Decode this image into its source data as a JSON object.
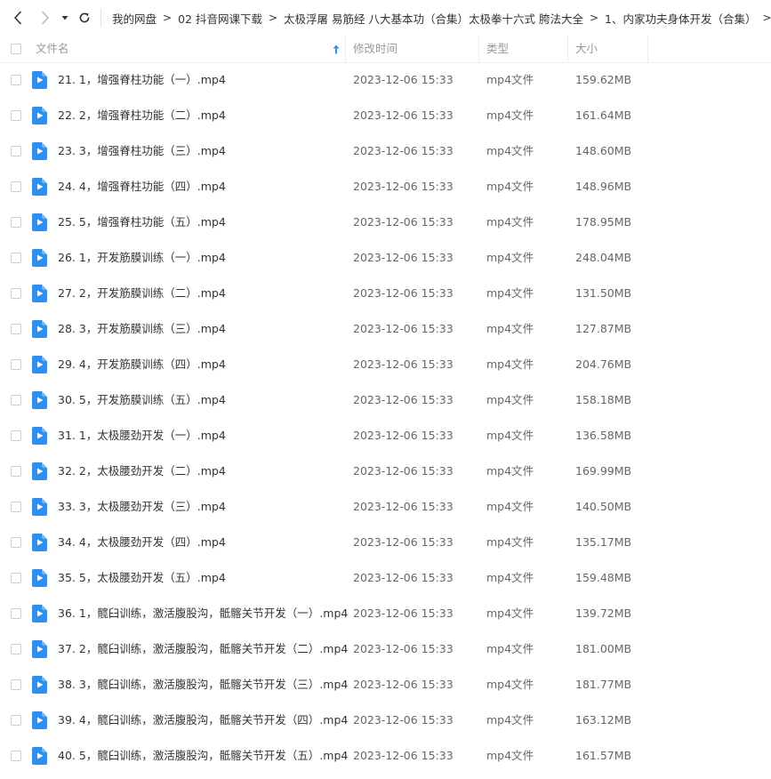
{
  "breadcrumb": [
    "我的网盘",
    "02 抖音网课下载",
    "太极浮屠 易筋经 八大基本功（合集）太极拳十六式 胯法大全",
    "1、内家功夫身体开发（合集）"
  ],
  "breadcrumb_separator": ">",
  "columns": {
    "name": "文件名",
    "modified": "修改时间",
    "type": "类型",
    "size": "大小"
  },
  "sort": {
    "column": "name",
    "direction": "ascending"
  },
  "colors": {
    "file_icon": "#2f8ff0",
    "sort_arrow": "#2f8ff0"
  },
  "files": [
    {
      "name": "21. 1，增强脊柱功能（一）.mp4",
      "modified": "2023-12-06 15:33",
      "type": "mp4文件",
      "size": "159.62MB"
    },
    {
      "name": "22. 2，增强脊柱功能（二）.mp4",
      "modified": "2023-12-06 15:33",
      "type": "mp4文件",
      "size": "161.64MB"
    },
    {
      "name": "23. 3，增强脊柱功能（三）.mp4",
      "modified": "2023-12-06 15:33",
      "type": "mp4文件",
      "size": "148.60MB"
    },
    {
      "name": "24. 4，增强脊柱功能（四）.mp4",
      "modified": "2023-12-06 15:33",
      "type": "mp4文件",
      "size": "148.96MB"
    },
    {
      "name": "25. 5，增强脊柱功能（五）.mp4",
      "modified": "2023-12-06 15:33",
      "type": "mp4文件",
      "size": "178.95MB"
    },
    {
      "name": "26. 1，开发筋膜训练（一）.mp4",
      "modified": "2023-12-06 15:33",
      "type": "mp4文件",
      "size": "248.04MB"
    },
    {
      "name": "27. 2，开发筋膜训练（二）.mp4",
      "modified": "2023-12-06 15:33",
      "type": "mp4文件",
      "size": "131.50MB"
    },
    {
      "name": "28. 3，开发筋膜训练（三）.mp4",
      "modified": "2023-12-06 15:33",
      "type": "mp4文件",
      "size": "127.87MB"
    },
    {
      "name": "29. 4，开发筋膜训练（四）.mp4",
      "modified": "2023-12-06 15:33",
      "type": "mp4文件",
      "size": "204.76MB"
    },
    {
      "name": "30. 5，开发筋膜训练（五）.mp4",
      "modified": "2023-12-06 15:33",
      "type": "mp4文件",
      "size": "158.18MB"
    },
    {
      "name": "31. 1，太极腰劲开发（一）.mp4",
      "modified": "2023-12-06 15:33",
      "type": "mp4文件",
      "size": "136.58MB"
    },
    {
      "name": "32. 2，太极腰劲开发（二）.mp4",
      "modified": "2023-12-06 15:33",
      "type": "mp4文件",
      "size": "169.99MB"
    },
    {
      "name": "33. 3，太极腰劲开发（三）.mp4",
      "modified": "2023-12-06 15:33",
      "type": "mp4文件",
      "size": "140.50MB"
    },
    {
      "name": "34. 4，太极腰劲开发（四）.mp4",
      "modified": "2023-12-06 15:33",
      "type": "mp4文件",
      "size": "135.17MB"
    },
    {
      "name": "35. 5，太极腰劲开发（五）.mp4",
      "modified": "2023-12-06 15:33",
      "type": "mp4文件",
      "size": "159.48MB"
    },
    {
      "name": "36. 1，髋臼训练，激活腹股沟，骶髂关节开发（一）.mp4",
      "modified": "2023-12-06 15:33",
      "type": "mp4文件",
      "size": "139.72MB"
    },
    {
      "name": "37. 2，髋臼训练，激活腹股沟，骶髂关节开发（二）.mp4",
      "modified": "2023-12-06 15:33",
      "type": "mp4文件",
      "size": "181.00MB"
    },
    {
      "name": "38. 3，髋臼训练，激活腹股沟，骶髂关节开发（三）.mp4",
      "modified": "2023-12-06 15:33",
      "type": "mp4文件",
      "size": "181.77MB"
    },
    {
      "name": "39. 4，髋臼训练，激活腹股沟，骶髂关节开发（四）.mp4",
      "modified": "2023-12-06 15:33",
      "type": "mp4文件",
      "size": "163.12MB"
    },
    {
      "name": "40. 5，髋臼训练，激活腹股沟，骶髂关节开发（五）.mp4",
      "modified": "2023-12-06 15:33",
      "type": "mp4文件",
      "size": "161.57MB"
    }
  ]
}
